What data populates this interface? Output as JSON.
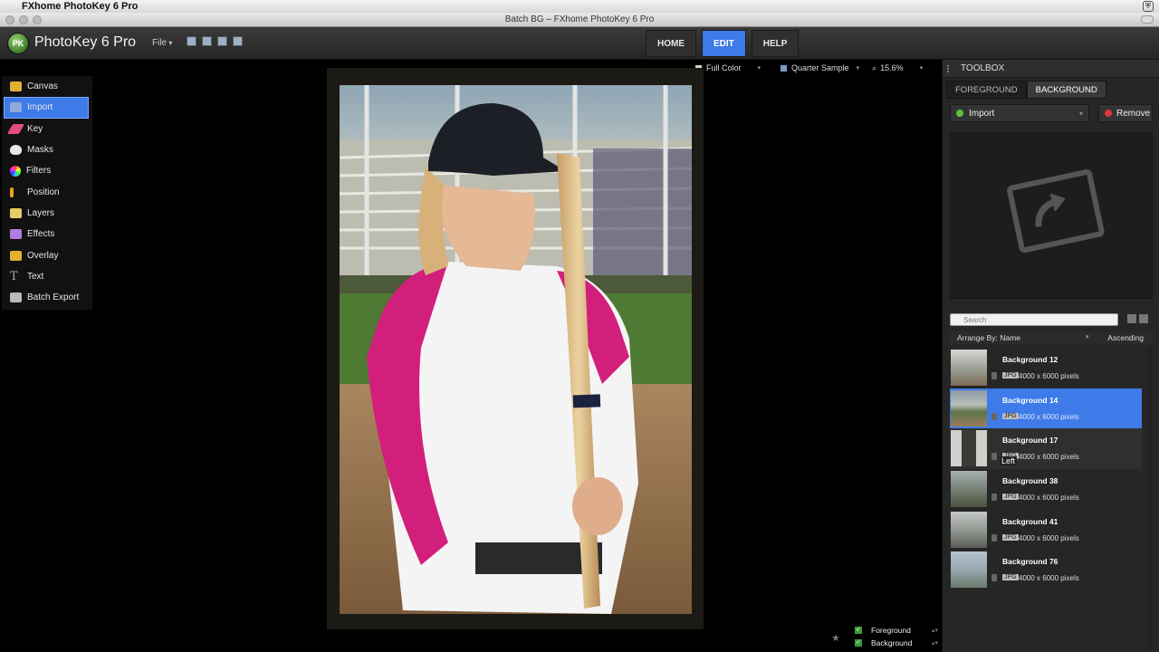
{
  "os_menu": {
    "app_name": "FXhome PhotoKey 6 Pro"
  },
  "window": {
    "title": "Batch BG – FXhome PhotoKey 6 Pro"
  },
  "header": {
    "logo_badge": "PK",
    "logo": "PhotoKey 6 Pro",
    "file_menu": "File",
    "nav": [
      {
        "label": "HOME"
      },
      {
        "label": "EDIT"
      },
      {
        "label": "HELP"
      }
    ]
  },
  "tools": [
    {
      "label": "Canvas",
      "icon": "canvas-icon",
      "color": "#e0b232"
    },
    {
      "label": "Import",
      "icon": "import-icon",
      "color": "#8fa9d9"
    },
    {
      "label": "Key",
      "icon": "key-icon",
      "color": "#e54d7a"
    },
    {
      "label": "Masks",
      "icon": "masks-icon",
      "color": "#e8e8e8"
    },
    {
      "label": "Filters",
      "icon": "filters-icon",
      "color": "#ff7a3d"
    },
    {
      "label": "Position",
      "icon": "position-icon",
      "color": "#f0a020"
    },
    {
      "label": "Layers",
      "icon": "layers-icon",
      "color": "#e6cc66"
    },
    {
      "label": "Effects",
      "icon": "effects-icon",
      "color": "#b47ce0"
    },
    {
      "label": "Overlay",
      "icon": "overlay-icon",
      "color": "#e4b030"
    },
    {
      "label": "Text",
      "icon": "text-icon",
      "color": "#aaaaaa"
    },
    {
      "label": "Batch Export",
      "icon": "batch-export-icon",
      "color": "#bbbbbb"
    }
  ],
  "view": {
    "color_mode": "Full Color",
    "sample": "Quarter Sample",
    "zoom": "15.6%"
  },
  "toolbox": {
    "title": "TOOLBOX",
    "tabs": [
      {
        "label": "FOREGROUND"
      },
      {
        "label": "BACKGROUND"
      }
    ],
    "import_label": "Import",
    "remove_label": "Remove",
    "search_placeholder": "Search",
    "arrange_label": "Arrange By: Name",
    "order_label": "Ascending",
    "items": [
      {
        "name": "Background 12",
        "format": "JPG",
        "dims": "4000 x 6000 pixels"
      },
      {
        "name": "Background 14",
        "format": "JPG",
        "dims": "4000 x 6000 pixels"
      },
      {
        "name": "Background 17",
        "format": "JPG",
        "dims": "4000 x 6000 pixels"
      },
      {
        "name": "Background 38",
        "format": "JPG",
        "dims": "4000 x 6000 pixels"
      },
      {
        "name": "Background 41",
        "format": "JPG",
        "dims": "4000 x 6000 pixels"
      },
      {
        "name": "Background 76",
        "format": "JPG",
        "dims": "4000 x 6000 pixels"
      }
    ],
    "tooltip": "Left"
  },
  "layers": [
    {
      "label": "Foreground"
    },
    {
      "label": "Background"
    }
  ],
  "colors": {
    "accent": "#3e7ae8",
    "add": "#5ec13d",
    "remove": "#e0393d"
  }
}
